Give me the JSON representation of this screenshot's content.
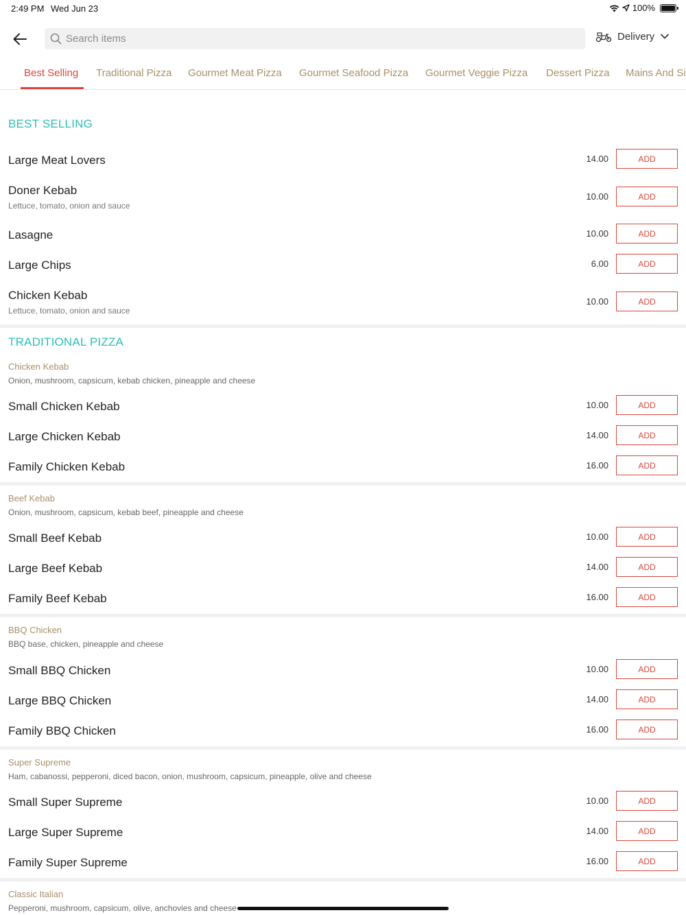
{
  "status": {
    "time": "2:49 PM",
    "date": "Wed Jun 23",
    "battery": "100%"
  },
  "header": {
    "search_placeholder": "Search items",
    "delivery_label": "Delivery"
  },
  "tabs": [
    {
      "label": "Best Selling"
    },
    {
      "label": "Traditional Pizza"
    },
    {
      "label": "Gourmet Meat Pizza"
    },
    {
      "label": "Gourmet Seafood Pizza"
    },
    {
      "label": "Gourmet Veggie Pizza"
    },
    {
      "label": "Dessert Pizza"
    },
    {
      "label": "Mains And Si"
    }
  ],
  "best_selling": {
    "title": "BEST SELLING",
    "items": [
      {
        "name": "Large Meat Lovers",
        "desc": "",
        "price": "14.00",
        "add": "ADD"
      },
      {
        "name": "Doner Kebab",
        "desc": "Lettuce, tomato, onion and sauce",
        "price": "10.00",
        "add": "ADD"
      },
      {
        "name": "Lasagne",
        "desc": "",
        "price": "10.00",
        "add": "ADD"
      },
      {
        "name": "Large Chips",
        "desc": "",
        "price": "6.00",
        "add": "ADD"
      },
      {
        "name": "Chicken Kebab",
        "desc": "Lettuce, tomato, onion and sauce",
        "price": "10.00",
        "add": "ADD"
      }
    ]
  },
  "traditional_pizza": {
    "title": "TRADITIONAL PIZZA",
    "groups": [
      {
        "title": "Chicken Kebab",
        "desc": "Onion, mushroom, capsicum, kebab chicken, pineapple and cheese",
        "items": [
          {
            "name": "Small Chicken Kebab",
            "price": "10.00",
            "add": "ADD"
          },
          {
            "name": "Large Chicken Kebab",
            "price": "14.00",
            "add": "ADD"
          },
          {
            "name": "Family Chicken Kebab",
            "price": "16.00",
            "add": "ADD"
          }
        ]
      },
      {
        "title": "Beef Kebab",
        "desc": "Onion, mushroom, capsicum, kebab beef, pineapple and cheese",
        "items": [
          {
            "name": "Small Beef Kebab",
            "price": "10.00",
            "add": "ADD"
          },
          {
            "name": "Large Beef Kebab",
            "price": "14.00",
            "add": "ADD"
          },
          {
            "name": "Family Beef Kebab",
            "price": "16.00",
            "add": "ADD"
          }
        ]
      },
      {
        "title": "BBQ Chicken",
        "desc": "BBQ base, chicken, pineapple and cheese",
        "items": [
          {
            "name": "Small BBQ Chicken",
            "price": "10.00",
            "add": "ADD"
          },
          {
            "name": "Large BBQ Chicken",
            "price": "14.00",
            "add": "ADD"
          },
          {
            "name": "Family BBQ Chicken",
            "price": "16.00",
            "add": "ADD"
          }
        ]
      },
      {
        "title": "Super Supreme",
        "desc": "Ham, cabanossi, pepperoni, diced bacon, onion, mushroom, capsicum, pineapple, olive and cheese",
        "items": [
          {
            "name": "Small Super Supreme",
            "price": "10.00",
            "add": "ADD"
          },
          {
            "name": "Large Super Supreme",
            "price": "14.00",
            "add": "ADD"
          },
          {
            "name": "Family Super Supreme",
            "price": "16.00",
            "add": "ADD"
          }
        ]
      },
      {
        "title": "Classic Italian",
        "desc": "Pepperoni, mushroom, capsicum, olive, anchovies and cheese",
        "items": []
      }
    ]
  },
  "colors": {
    "accent": "#d9473a",
    "section": "#2bbfb4",
    "category": "#a89068"
  }
}
